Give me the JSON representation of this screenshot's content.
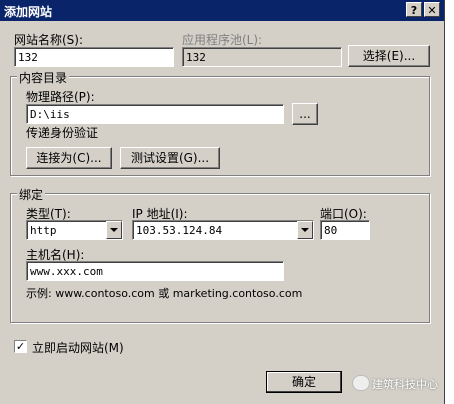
{
  "window": {
    "title": "添加网站",
    "help_glyph": "?",
    "close_glyph": "✕"
  },
  "site_name": {
    "label": "网站名称(S):",
    "value": "132"
  },
  "app_pool": {
    "label": "应用程序池(L):",
    "value": "132",
    "select_button": "选择(E)..."
  },
  "content_dir": {
    "group_title": "内容目录",
    "path_label": "物理路径(P):",
    "path_value": "D:\\iis",
    "browse_button": "...",
    "auth_label": "传递身份验证",
    "connect_as_button": "连接为(C)...",
    "test_settings_button": "测试设置(G)..."
  },
  "binding": {
    "group_title": "绑定",
    "type_label": "类型(T):",
    "type_value": "http",
    "ip_label": "IP 地址(I):",
    "ip_value": "103.53.124.84",
    "port_label": "端口(O):",
    "port_value": "80",
    "host_label": "主机名(H):",
    "host_value": "www.xxx.com",
    "example_text": "示例: www.contoso.com 或 marketing.contoso.com"
  },
  "start_now": {
    "label": "立即启动网站(M)",
    "checked": true,
    "check_glyph": "✓"
  },
  "ok_button": "确定",
  "watermark": "建筑科技中心"
}
